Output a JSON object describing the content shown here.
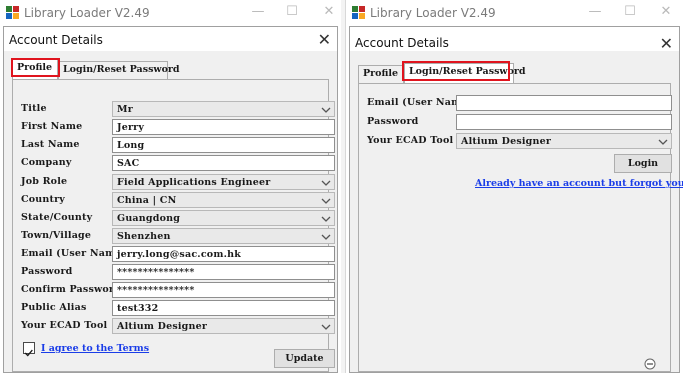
{
  "app": {
    "title": "Library Loader V2.49",
    "close_glyph": "✕",
    "min_glyph": "—",
    "max_glyph": "☐"
  },
  "dialog": {
    "title": "Account Details",
    "close_glyph": "✕"
  },
  "tabs": {
    "profile": "Profile",
    "login": "Login/Reset Password"
  },
  "profile": {
    "fields": [
      {
        "label": "Title",
        "value": "Mr",
        "type": "select"
      },
      {
        "label": "First Name",
        "value": "Jerry",
        "type": "text"
      },
      {
        "label": "Last Name",
        "value": "Long",
        "type": "text"
      },
      {
        "label": "Company",
        "value": "SAC",
        "type": "text"
      },
      {
        "label": "Job Role",
        "value": "Field Applications Engineer",
        "type": "select"
      },
      {
        "label": "Country",
        "value": "China | CN",
        "type": "select"
      },
      {
        "label": "State/County",
        "value": "Guangdong",
        "type": "select"
      },
      {
        "label": "Town/Village",
        "value": "Shenzhen",
        "type": "select"
      },
      {
        "label": "Email (User Name)",
        "value": "jerry.long@sac.com.hk",
        "type": "text"
      },
      {
        "label": "Password",
        "value": "***************",
        "type": "text"
      },
      {
        "label": "Confirm Password",
        "value": "***************",
        "type": "text"
      },
      {
        "label": "Public Alias",
        "value": "test332",
        "type": "text"
      },
      {
        "label": "Your ECAD Tool",
        "value": "Altium Designer",
        "type": "select"
      }
    ],
    "terms_label": "I agree to the Terms",
    "terms_checked": true,
    "update_label": "Update"
  },
  "login": {
    "email_label": "Email (User Name)",
    "email_value": "",
    "password_label": "Password",
    "password_value": "",
    "ecad_label": "Your ECAD Tool",
    "ecad_value": "Altium Designer",
    "login_label": "Login",
    "forgot_link": "Already have an account but forgot your pa"
  },
  "colors": {
    "highlight": "#e0141e",
    "link": "#1a3de8",
    "panel": "#f0f0f0"
  }
}
